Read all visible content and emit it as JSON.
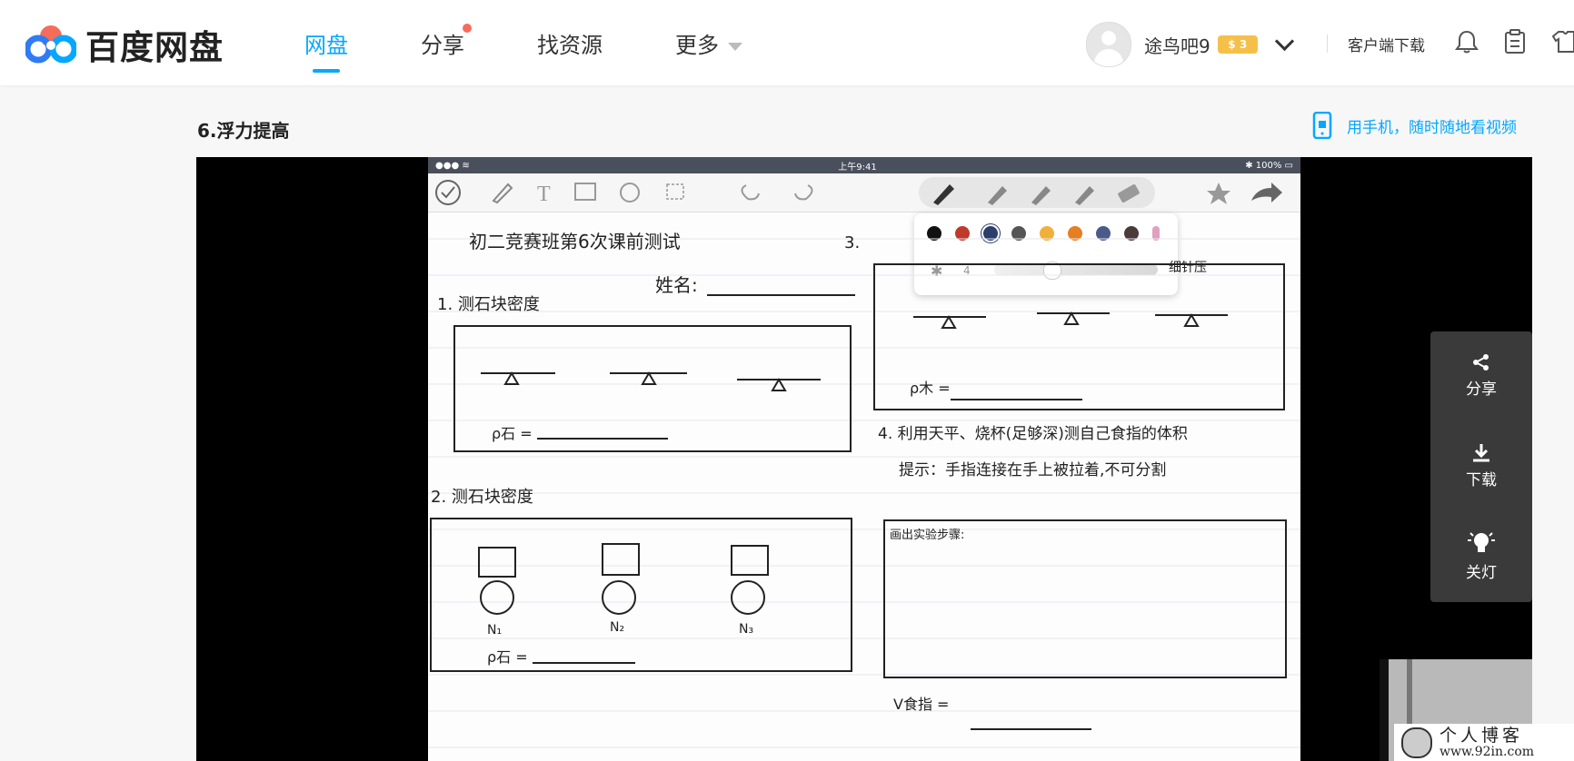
{
  "header": {
    "brand": "百度网盘",
    "nav": [
      {
        "label": "网盘",
        "active": true
      },
      {
        "label": "分享",
        "badge": true
      },
      {
        "label": "找资源"
      },
      {
        "label": "更多",
        "caret": true
      }
    ],
    "user": {
      "name": "途鸟吧9",
      "vip_level": "3"
    },
    "client_download": "客户端下载",
    "icons": [
      "bell-icon",
      "clipboard-icon",
      "shirt-icon"
    ]
  },
  "page": {
    "title": "6.浮力提高",
    "mobile_hint": "用手机，随时随地看视频"
  },
  "video": {
    "status_time": "上午9:41",
    "battery": "100%",
    "pen_size": "4",
    "worksheet": {
      "heading": "初二竞赛班第6次课前测试",
      "name_label": "姓名:",
      "q1": "1. 测石块密度",
      "q1_formula": "ρ石 =",
      "q2": "2. 测石块密度",
      "q2_formula": "ρ石 =",
      "q2_labels": [
        "N₁",
        "N₂",
        "N₃"
      ],
      "q3": "3.",
      "q3_note": "细针压",
      "q3_formula": "ρ木 =",
      "q4": "4. 利用天平、烧杯(足够深)测自己食指的体积",
      "q4_hint": "提示：手指连接在手上被拉着,不可分割",
      "q4_box": "画出实验步骤:",
      "q4_formula": "V食指 ="
    },
    "palette_colors": [
      "#111111",
      "#c0392b",
      "#2c3e6b",
      "#555555",
      "#f0b03a",
      "#e67e22",
      "#4a5a8a",
      "#4b3a3a",
      "#e0a0c0"
    ]
  },
  "side_panel": {
    "share": "分享",
    "download": "下载",
    "light": "关灯"
  },
  "watermark": {
    "line1": "个人博客",
    "line2": "www.92in.com"
  }
}
